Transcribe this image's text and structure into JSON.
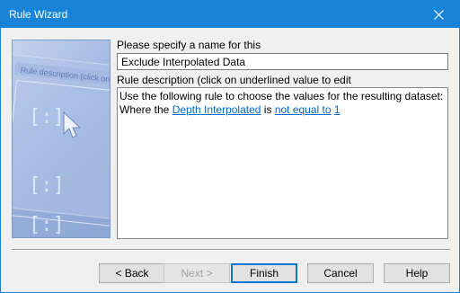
{
  "window": {
    "title": "Rule Wizard"
  },
  "side_image": {
    "overlay_text": "Rule description (click on u"
  },
  "form": {
    "name_label": "Please specify a name for this",
    "name_value": "Exclude Interpolated Data",
    "description_label": "Rule description (click on underlined value to edit",
    "description": {
      "line1": "Use the following rule to choose the values for the resulting dataset:",
      "where_text": "Where the",
      "field_link": "Depth Interpolated",
      "is_text": "is",
      "operator_link": "not equal to",
      "value_link": "1"
    }
  },
  "buttons": {
    "back": "< Back",
    "next": "Next >",
    "finish": "Finish",
    "cancel": "Cancel",
    "help": "Help"
  },
  "colors": {
    "titlebar": "#1883d7",
    "link": "#0066cc",
    "default_button_border": "#0078d7"
  }
}
